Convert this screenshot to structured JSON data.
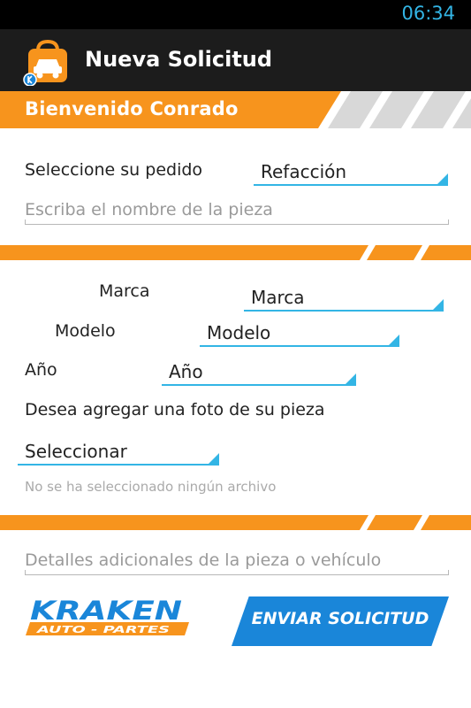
{
  "status_bar": {
    "time": "06:34"
  },
  "action_bar": {
    "title": "Nueva Solicitud",
    "icon": "kraken-app-icon"
  },
  "welcome": {
    "text": "Bienvenido  Conrado"
  },
  "order": {
    "label": "Seleccione su pedido",
    "value": "Refacción",
    "part_name_placeholder": "Escriba el nombre de la pieza"
  },
  "vehicle": {
    "brand_label": "Marca",
    "brand_value": "Marca",
    "model_label": "Modelo",
    "model_value": "Modelo",
    "year_label": "Año",
    "year_value": "Año"
  },
  "photo": {
    "prompt": "Desea agregar una foto de su pieza",
    "select_value": "Seleccionar",
    "no_file_text": "No se ha seleccionado ningún archivo"
  },
  "details": {
    "placeholder": "Detalles adicionales de la pieza o vehículo"
  },
  "footer": {
    "logo_main": "KRAKEN",
    "logo_sub": "AUTO - PARTES",
    "send_label": "ENVIAR SOLICITUD"
  },
  "colors": {
    "accent_orange": "#f7941d",
    "accent_blue": "#33b5e5",
    "button_blue": "#1a86d9",
    "action_bar": "#1c1c1c"
  }
}
